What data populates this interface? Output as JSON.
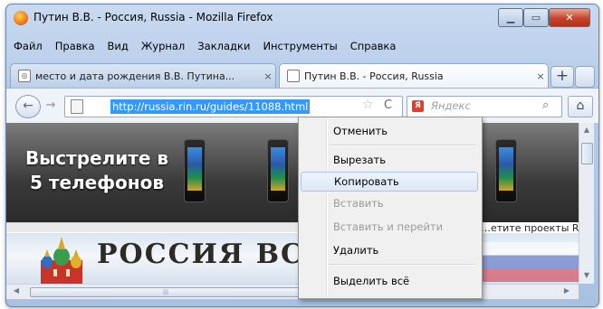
{
  "window": {
    "title": "Путин В.В. - Россия, Russia - Mozilla Firefox",
    "caption_buttons": {
      "minimize_icon": "minimize-icon",
      "maximize_icon": "maximize-icon",
      "close_icon": "close-icon"
    }
  },
  "menubar": {
    "items": [
      "Файл",
      "Правка",
      "Вид",
      "Журнал",
      "Закладки",
      "Инструменты",
      "Справка"
    ]
  },
  "tabs": [
    {
      "label": "место и дата рождения В.В. Путина...",
      "close": "×",
      "active": false
    },
    {
      "label": "Путин В.В. - Россия, Russia",
      "close": "×",
      "active": true
    }
  ],
  "tabbar": {
    "new_tab": "+"
  },
  "navbar": {
    "url": "http://russia.rin.ru/guides/11088.html",
    "search_placeholder": "Яндекс",
    "back": "←",
    "forward": "→",
    "reload": "C",
    "star": "☆",
    "home": "⌂",
    "search_go": "⌕"
  },
  "page": {
    "banner_title": "Выстрелите в 5 телефонов",
    "russia_banner_text": "РОССИЯ ВСЯ",
    "other_projects": "…етите проекты RI"
  },
  "context_menu": {
    "items": [
      {
        "label": "Отменить",
        "disabled": false,
        "highlight": false
      },
      {
        "label": "Вырезать",
        "disabled": false,
        "highlight": false
      },
      {
        "label": "Копировать",
        "disabled": false,
        "highlight": true
      },
      {
        "label": "Вставить",
        "disabled": true,
        "highlight": false
      },
      {
        "label": "Вставить и перейти",
        "disabled": true,
        "highlight": false
      },
      {
        "label": "Удалить",
        "disabled": false,
        "highlight": false
      },
      {
        "label": "Выделить всё",
        "disabled": false,
        "highlight": false
      }
    ]
  },
  "colors": {
    "selection": "#3399ff",
    "chrome": "#b4cbe8",
    "close_button": "#c5432a"
  }
}
